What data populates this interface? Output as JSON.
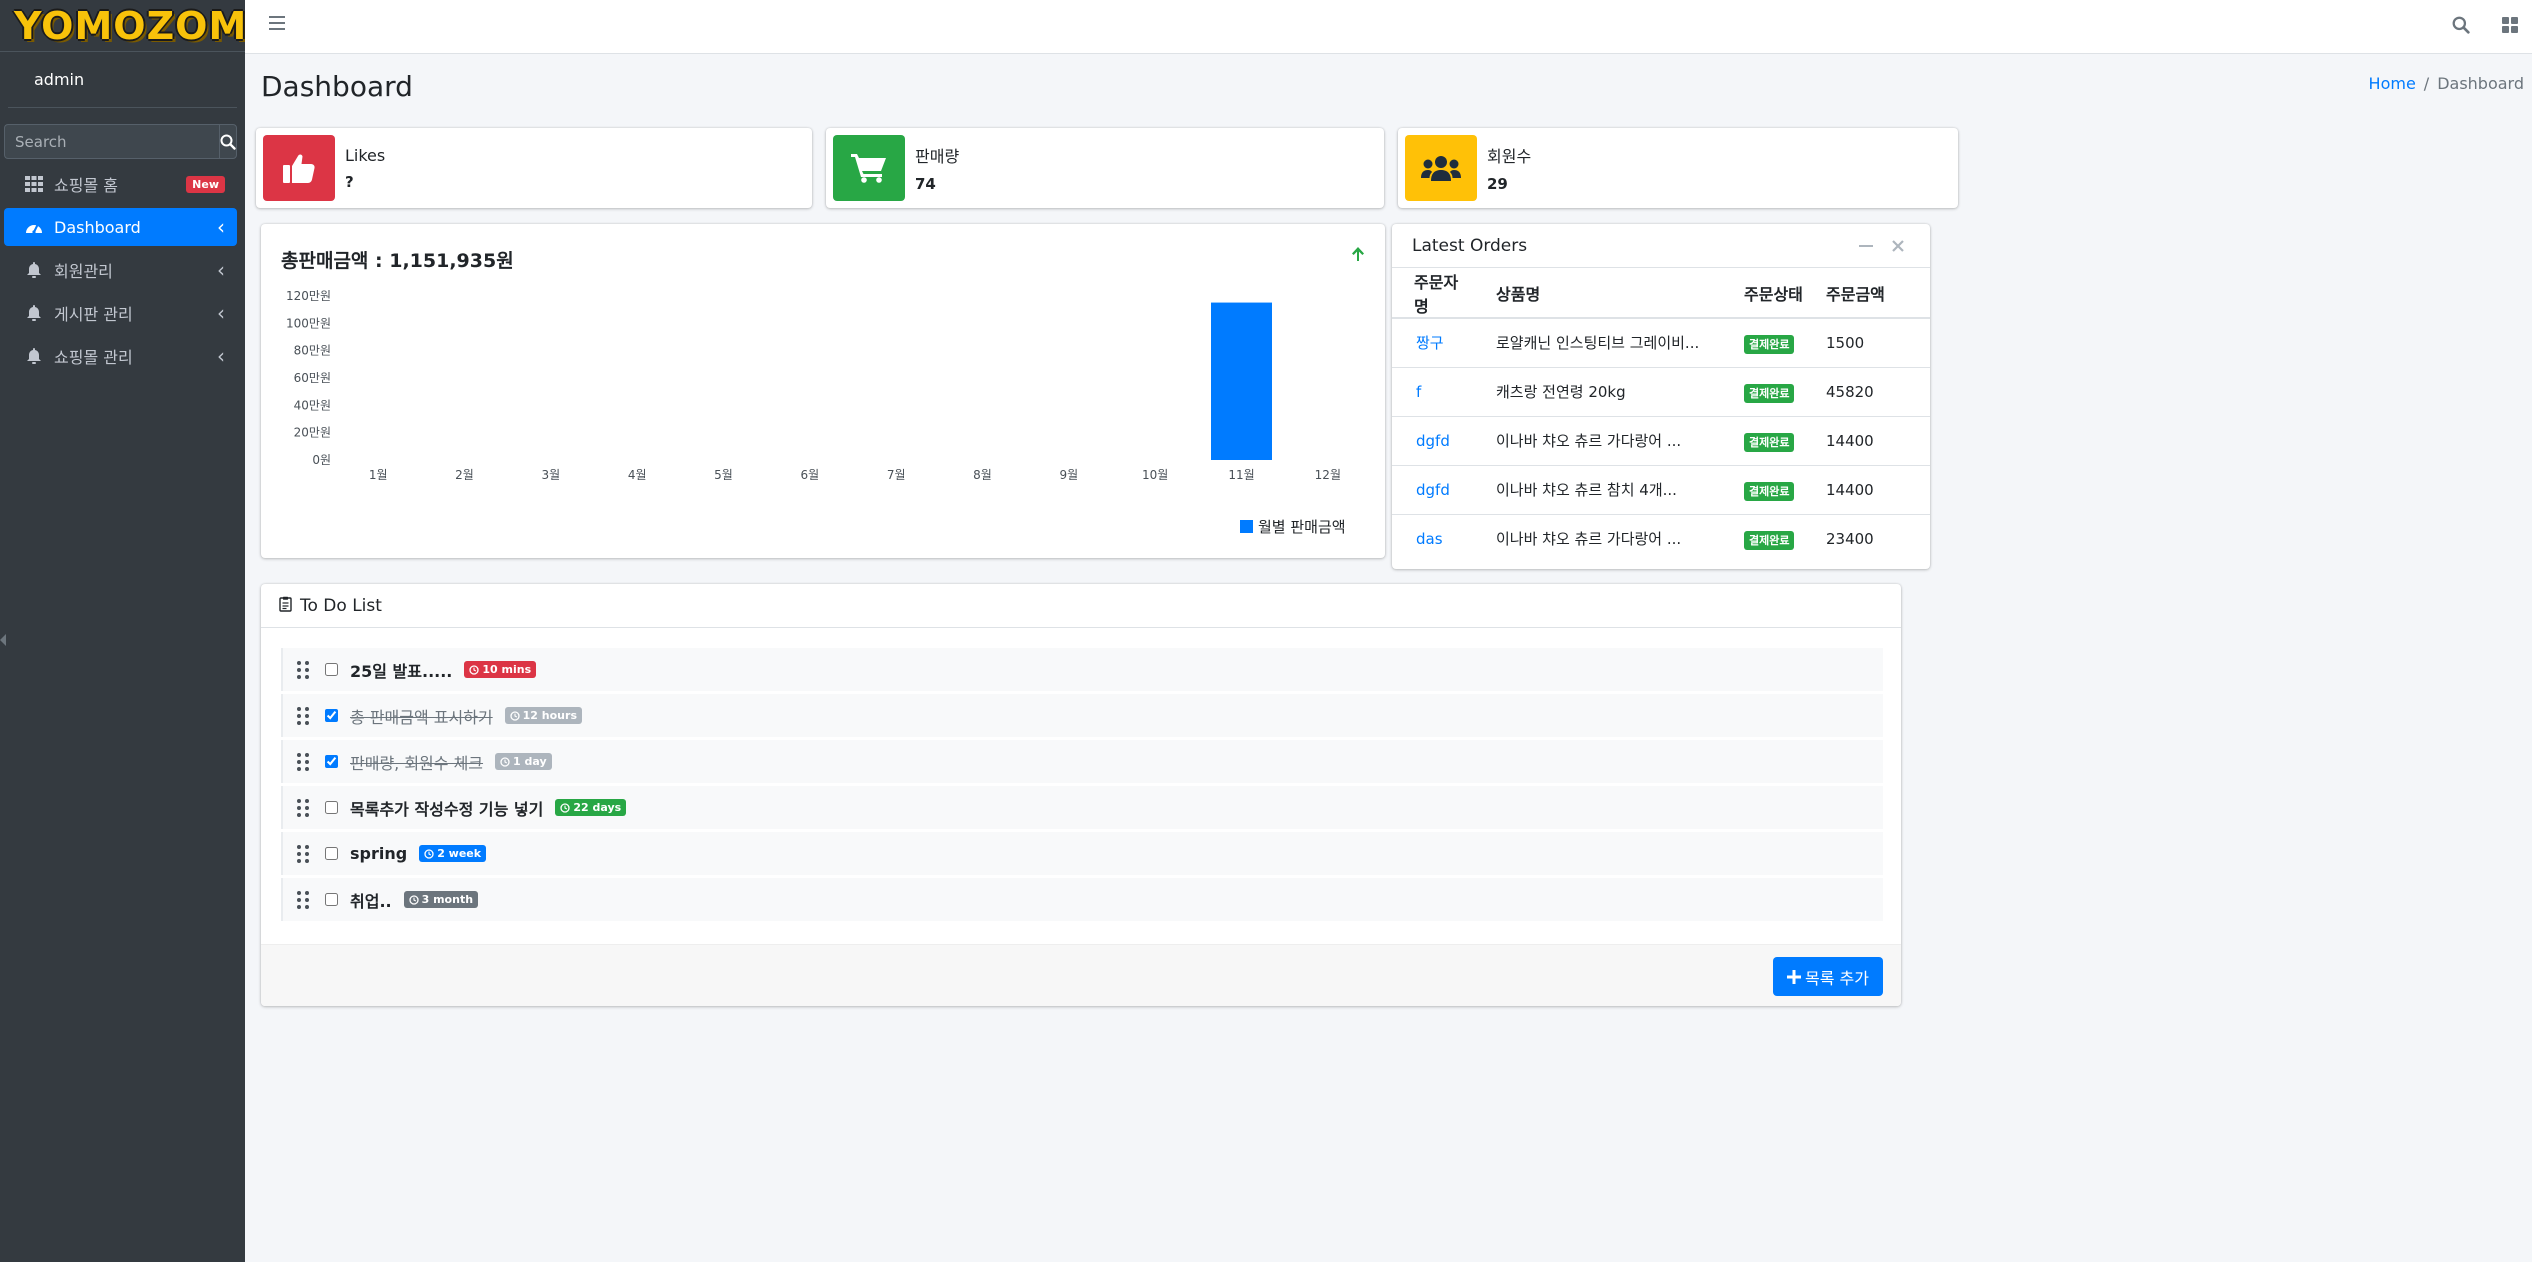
{
  "brand": {
    "logo_text": "YOMOZOMO"
  },
  "user": {
    "name": "admin"
  },
  "sidebar": {
    "search_placeholder": "Search",
    "items": [
      {
        "label": "쇼핑몰 홈",
        "icon": "grid-icon",
        "badge": "New"
      },
      {
        "label": "Dashboard",
        "icon": "dashboard-icon",
        "active": true
      },
      {
        "label": "회원관리",
        "icon": "bell-icon"
      },
      {
        "label": "게시판 관리",
        "icon": "bell-icon"
      },
      {
        "label": "쇼핑몰 관리",
        "icon": "bell-icon"
      }
    ]
  },
  "header": {
    "title": "Dashboard",
    "breadcrumb": {
      "home": "Home",
      "separator": "/",
      "current": "Dashboard"
    }
  },
  "info_boxes": [
    {
      "label": "Likes",
      "value": "?",
      "icon": "thumbs-up-icon",
      "color": "#dc3545"
    },
    {
      "label": "판매량",
      "value": "74",
      "icon": "cart-icon",
      "color": "#28a745"
    },
    {
      "label": "회원수",
      "value": "29",
      "icon": "users-icon",
      "color": "#ffc107"
    }
  ],
  "sales": {
    "title": "총판매금액 : 1,151,935원",
    "trend_icon": "arrow-up-icon",
    "trend_color": "#28a745"
  },
  "chart_data": {
    "type": "bar",
    "categories": [
      "1월",
      "2월",
      "3월",
      "4월",
      "5월",
      "6월",
      "7월",
      "8월",
      "9월",
      "10월",
      "11월",
      "12월"
    ],
    "series": [
      {
        "name": "월별 판매금액",
        "color": "#007bff",
        "values": [
          0,
          0,
          0,
          0,
          0,
          0,
          0,
          0,
          0,
          0,
          1151935,
          0
        ]
      }
    ],
    "y_ticks": [
      "0원",
      "20만원",
      "40만원",
      "60만원",
      "80만원",
      "100만원",
      "120만원"
    ],
    "ylim": [
      0,
      1200000
    ],
    "legend_position": "bottom-right",
    "grid": false
  },
  "orders": {
    "title": "Latest Orders",
    "columns": [
      "주문자명",
      "상품명",
      "주문상태",
      "주문금액"
    ],
    "rows": [
      {
        "buyer": "짱구",
        "product": "로얄캐닌 인스팅티브 그레이비...",
        "status": "결제완료",
        "amount": "1500"
      },
      {
        "buyer": "f",
        "product": "캐츠랑 전연령 20kg",
        "status": "결제완료",
        "amount": "45820"
      },
      {
        "buyer": "dgfd",
        "product": "이나바 챠오 츄르 가다랑어 ...",
        "status": "결제완료",
        "amount": "14400"
      },
      {
        "buyer": "dgfd",
        "product": "이나바 챠오 츄르 참치 4개...",
        "status": "결제완료",
        "amount": "14400"
      },
      {
        "buyer": "das",
        "product": "이나바 챠오 츄르 가다랑어 ...",
        "status": "결제완료",
        "amount": "23400"
      }
    ]
  },
  "todo": {
    "title": "To Do List",
    "items": [
      {
        "text": "25일 발표.....",
        "checked": false,
        "time": "10 mins",
        "color": "#dc3545"
      },
      {
        "text": "총 판매금액 표시하기",
        "checked": true,
        "time": "12 hours",
        "color": "#adb5bd"
      },
      {
        "text": "판매량, 회원수 체크",
        "checked": true,
        "time": "1 day",
        "color": "#adb5bd"
      },
      {
        "text": "목록추가 작성수정 기능 넣기",
        "checked": false,
        "time": "22 days",
        "color": "#28a745"
      },
      {
        "text": "spring",
        "checked": false,
        "time": "2 week",
        "color": "#007bff"
      },
      {
        "text": "취업..",
        "checked": false,
        "time": "3 month",
        "color": "#6c757d"
      }
    ],
    "add_label": "목록 추가"
  }
}
